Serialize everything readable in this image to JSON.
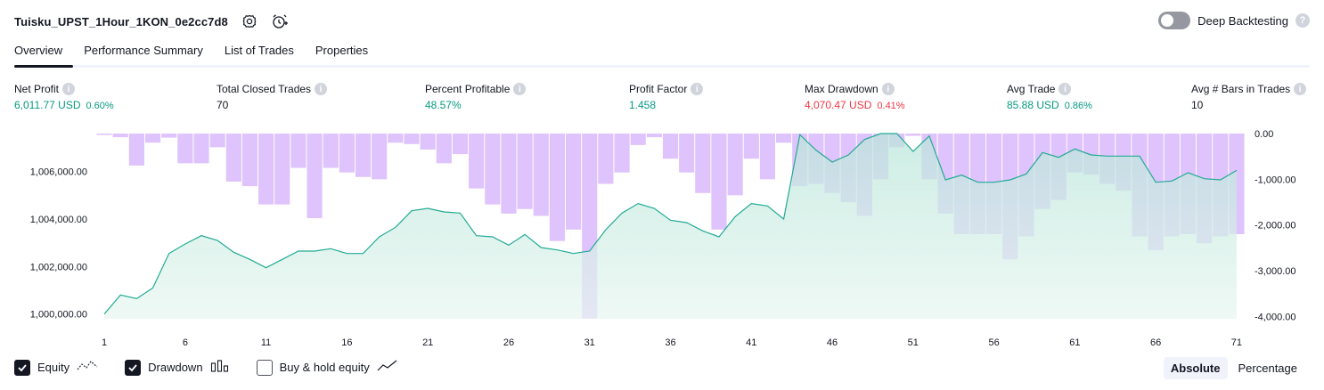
{
  "header": {
    "strategy_title": "Tuisku_UPST_1Hour_1KON_0e2cc7d8",
    "settings_icon": "gear-icon",
    "alert_icon": "add-alert-icon"
  },
  "deep_backtesting": {
    "label": "Deep Backtesting",
    "enabled": false,
    "help": "?"
  },
  "tabs": [
    {
      "label": "Overview",
      "active": true
    },
    {
      "label": "Performance Summary",
      "active": false
    },
    {
      "label": "List of Trades",
      "active": false
    },
    {
      "label": "Properties",
      "active": false
    }
  ],
  "metrics": {
    "net_profit": {
      "label": "Net Profit",
      "value": "6,011.77 USD",
      "pct": "0.60%"
    },
    "total_closed_trades": {
      "label": "Total Closed Trades",
      "value": "70"
    },
    "percent_profitable": {
      "label": "Percent Profitable",
      "value": "48.57%"
    },
    "profit_factor": {
      "label": "Profit Factor",
      "value": "1.458"
    },
    "max_drawdown": {
      "label": "Max Drawdown",
      "value": "4,070.47 USD",
      "pct": "0.41%"
    },
    "avg_trade": {
      "label": "Avg Trade",
      "value": "85.88 USD",
      "pct": "0.86%"
    },
    "avg_bars": {
      "label": "Avg # Bars in Trades",
      "value": "10"
    }
  },
  "colors": {
    "positive": "#089981",
    "negative": "#f23645",
    "equity_line": "#22ab94",
    "equity_fill": "#cdeee5",
    "drawdown_fill": "#d9b8fb",
    "text": "#131722"
  },
  "chart_data": {
    "type": "area",
    "x": [
      1,
      2,
      3,
      4,
      5,
      6,
      7,
      8,
      9,
      10,
      11,
      12,
      13,
      14,
      15,
      16,
      17,
      18,
      19,
      20,
      21,
      22,
      23,
      24,
      25,
      26,
      27,
      28,
      29,
      30,
      31,
      32,
      33,
      34,
      35,
      36,
      37,
      38,
      39,
      40,
      41,
      42,
      43,
      44,
      45,
      46,
      47,
      48,
      49,
      50,
      51,
      52,
      53,
      54,
      55,
      56,
      57,
      58,
      59,
      60,
      61,
      62,
      63,
      64,
      65,
      66,
      67,
      68,
      69,
      70,
      71
    ],
    "x_ticks": [
      1,
      6,
      11,
      16,
      21,
      26,
      31,
      36,
      41,
      46,
      51,
      56,
      61,
      66,
      71
    ],
    "left_axis": {
      "min": 999800,
      "max": 1007600,
      "ticks": [
        1000000,
        1002000,
        1004000,
        1006000
      ],
      "tick_labels": [
        "1,000,000.00",
        "1,002,000.00",
        "1,004,000.00",
        "1,006,000.00"
      ]
    },
    "right_axis": {
      "min": -4050,
      "max": 0,
      "ticks": [
        0,
        -1000,
        -2000,
        -3000,
        -4000
      ],
      "tick_labels": [
        "0.00",
        "-1,000.00",
        "-2,000.00",
        "-3,000.00",
        "-4,000.00"
      ]
    },
    "series": [
      {
        "name": "Equity",
        "axis": "left",
        "values": [
          1000000,
          1000800,
          1000650,
          1001100,
          1002550,
          1002950,
          1003300,
          1003100,
          1002600,
          1002300,
          1001950,
          1002300,
          1002650,
          1002650,
          1002750,
          1002550,
          1002550,
          1003250,
          1003650,
          1004350,
          1004450,
          1004300,
          1004250,
          1003300,
          1003250,
          1002900,
          1003350,
          1002800,
          1002700,
          1002550,
          1002650,
          1003550,
          1004250,
          1004650,
          1004450,
          1003950,
          1003850,
          1003500,
          1003250,
          1004100,
          1004650,
          1004550,
          1004000,
          1007550,
          1006900,
          1006400,
          1006700,
          1007350,
          1007600,
          1007600,
          1006850,
          1007500,
          1005650,
          1005850,
          1005550,
          1005550,
          1005650,
          1005900,
          1006800,
          1006600,
          1006950,
          1006700,
          1006650,
          1006650,
          1006650,
          1005550,
          1005600,
          1005950,
          1005700,
          1005650,
          1006050
        ]
      },
      {
        "name": "Drawdown",
        "axis": "right",
        "values": [
          -30,
          -80,
          -700,
          -200,
          -90,
          -650,
          -650,
          -300,
          -1050,
          -1150,
          -1550,
          -1550,
          -750,
          -1850,
          -750,
          -850,
          -950,
          -1000,
          -200,
          -230,
          -350,
          -650,
          -450,
          -1200,
          -1550,
          -1750,
          -1650,
          -1800,
          -2350,
          -2100,
          -4050,
          -1100,
          -850,
          -250,
          -80,
          -550,
          -850,
          -1300,
          -2100,
          -1350,
          -550,
          -1000,
          -200,
          -1150,
          -1100,
          -1300,
          -1500,
          -1800,
          -1000,
          -300,
          -50,
          -1000,
          -1750,
          -2200,
          -2200,
          -2200,
          -2750,
          -2250,
          -1650,
          -1450,
          -850,
          -900,
          -1100,
          -1250,
          -2250,
          -2550,
          -2250,
          -2200,
          -2400,
          -2250,
          -2200
        ]
      }
    ]
  },
  "legend": {
    "equity": {
      "label": "Equity",
      "checked": true
    },
    "drawdown": {
      "label": "Drawdown",
      "checked": true
    },
    "buy_hold": {
      "label": "Buy & hold equity",
      "checked": false
    }
  },
  "mode": {
    "absolute": "Absolute",
    "percentage": "Percentage",
    "selected": "absolute"
  }
}
